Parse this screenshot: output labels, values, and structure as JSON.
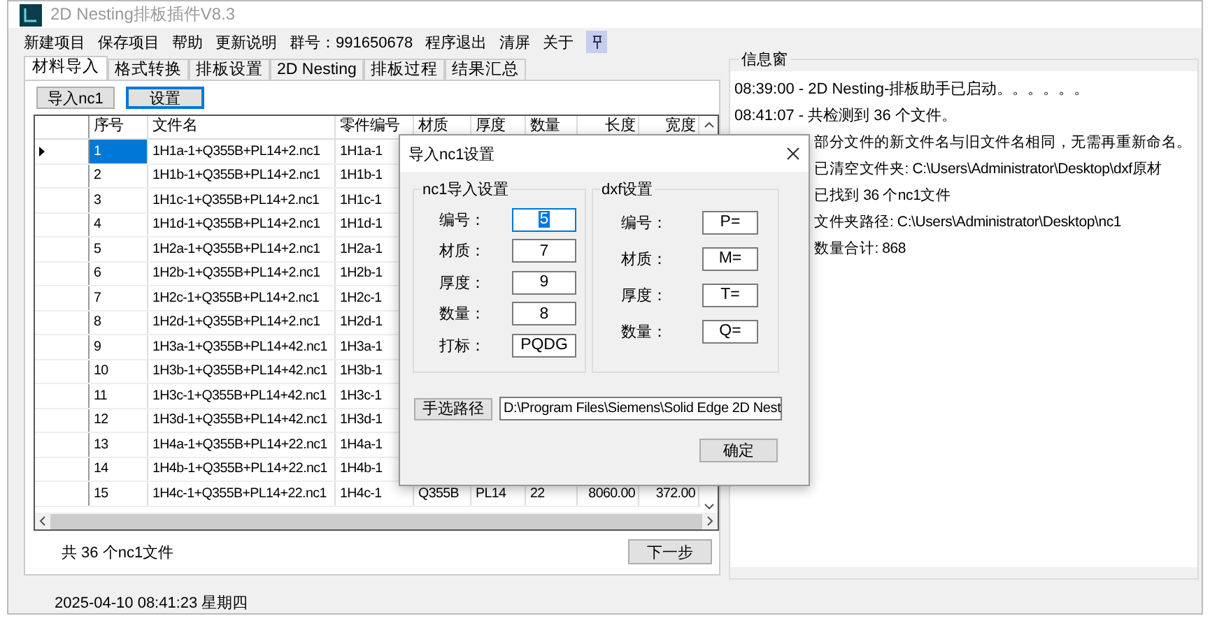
{
  "window": {
    "title": "2D Nesting排板插件V8.3"
  },
  "menu": [
    {
      "label": "新建项目"
    },
    {
      "label": "保存项目"
    },
    {
      "label": "帮助"
    },
    {
      "label": "更新说明"
    },
    {
      "label": "群号：991650678"
    },
    {
      "label": "程序退出"
    },
    {
      "label": "清屏"
    },
    {
      "label": "关于"
    }
  ],
  "tabs": [
    {
      "label": "材料导入",
      "selected": true
    },
    {
      "label": "格式转换",
      "selected": false
    },
    {
      "label": "排板设置",
      "selected": false
    },
    {
      "label": "2D Nesting",
      "selected": false
    },
    {
      "label": "排板过程",
      "selected": false
    },
    {
      "label": "结果汇总",
      "selected": false
    }
  ],
  "toolbar": [
    {
      "label": "导入nc1",
      "focused": false
    },
    {
      "label": "设置",
      "focused": true
    }
  ],
  "table": {
    "columns": [
      "序号",
      "文件名",
      "零件编号",
      "材质",
      "厚度",
      "数量",
      "长度",
      "宽度"
    ],
    "rows": [
      {
        "cells": [
          "1",
          "1H1a-1+Q355B+PL14+2.nc1",
          "1H1a-1"
        ],
        "selected": true,
        "current": true
      },
      {
        "cells": [
          "2",
          "1H1b-1+Q355B+PL14+2.nc1",
          "1H1b-1"
        ],
        "selected": false,
        "current": false
      },
      {
        "cells": [
          "3",
          "1H1c-1+Q355B+PL14+2.nc1",
          "1H1c-1"
        ],
        "selected": false,
        "current": false
      },
      {
        "cells": [
          "4",
          "1H1d-1+Q355B+PL14+2.nc1",
          "1H1d-1"
        ],
        "selected": false,
        "current": false
      },
      {
        "cells": [
          "5",
          "1H2a-1+Q355B+PL14+2.nc1",
          "1H2a-1"
        ],
        "selected": false,
        "current": false
      },
      {
        "cells": [
          "6",
          "1H2b-1+Q355B+PL14+2.nc1",
          "1H2b-1"
        ],
        "selected": false,
        "current": false
      },
      {
        "cells": [
          "7",
          "1H2c-1+Q355B+PL14+2.nc1",
          "1H2c-1"
        ],
        "selected": false,
        "current": false
      },
      {
        "cells": [
          "8",
          "1H2d-1+Q355B+PL14+2.nc1",
          "1H2d-1"
        ],
        "selected": false,
        "current": false
      },
      {
        "cells": [
          "9",
          "1H3a-1+Q355B+PL14+42.nc1",
          "1H3a-1"
        ],
        "selected": false,
        "current": false
      },
      {
        "cells": [
          "10",
          "1H3b-1+Q355B+PL14+42.nc1",
          "1H3b-1"
        ],
        "selected": false,
        "current": false
      },
      {
        "cells": [
          "11",
          "1H3c-1+Q355B+PL14+42.nc1",
          "1H3c-1"
        ],
        "selected": false,
        "current": false
      },
      {
        "cells": [
          "12",
          "1H3d-1+Q355B+PL14+42.nc1",
          "1H3d-1"
        ],
        "selected": false,
        "current": false
      },
      {
        "cells": [
          "13",
          "1H4a-1+Q355B+PL14+22.nc1",
          "1H4a-1"
        ],
        "selected": false,
        "current": false
      },
      {
        "cells": [
          "14",
          "1H4b-1+Q355B+PL14+22.nc1",
          "1H4b-1"
        ],
        "selected": false,
        "current": false
      },
      {
        "cells": [
          "15",
          "1H4c-1+Q355B+PL14+22.nc1",
          "1H4c-1",
          "Q355B",
          "PL14",
          "22",
          "8060.00",
          "372.00"
        ],
        "selected": false,
        "current": false
      }
    ]
  },
  "file_count": "共 36 个nc1文件",
  "next_button": "下一步",
  "status_bar": "2025-04-10 08:41:23 星期四",
  "info_panel": {
    "title": "信息窗",
    "lines": [
      {
        "text": "08:39:00 - 2D Nesting-排板助手已启动。。。。。。",
        "kind": "full"
      },
      {
        "text": "08:41:07 - 共检测到 36 个文件。",
        "kind": "full"
      },
      {
        "text": "部分文件的新文件名与旧文件名相同，无需再重新命名。",
        "kind": "clipped"
      },
      {
        "text": "已清空文件夹: C:\\Users\\Administrator\\Desktop\\dxf原材",
        "kind": "clipped"
      },
      {
        "text": "已找到 36 个nc1文件",
        "kind": "clipped"
      },
      {
        "text": "文件夹路径: C:\\Users\\Administrator\\Desktop\\nc1",
        "kind": "clipped"
      },
      {
        "text": "数量合计: 868",
        "kind": "clipped"
      }
    ]
  },
  "dialog": {
    "title": "导入nc1设置",
    "groups": [
      {
        "title": "nc1导入设置",
        "fields": [
          {
            "label": "编号：",
            "value": "5",
            "focused": true
          },
          {
            "label": "材质：",
            "value": "7",
            "focused": false
          },
          {
            "label": "厚度：",
            "value": "9",
            "focused": false
          },
          {
            "label": "数量：",
            "value": "8",
            "focused": false
          },
          {
            "label": "打标：",
            "value": "PQDG",
            "focused": false
          }
        ]
      },
      {
        "title": "dxf设置",
        "fields": [
          {
            "label": "编号：",
            "value": "P=",
            "focused": false
          },
          {
            "label": "材质：",
            "value": "M=",
            "focused": false
          },
          {
            "label": "厚度：",
            "value": "T=",
            "focused": false
          },
          {
            "label": "数量：",
            "value": "Q=",
            "focused": false
          }
        ]
      }
    ],
    "path_button": "手选路径",
    "path_value": "D:\\Program Files\\Siemens\\Solid Edge 2D Nest",
    "ok_button": "确定"
  }
}
